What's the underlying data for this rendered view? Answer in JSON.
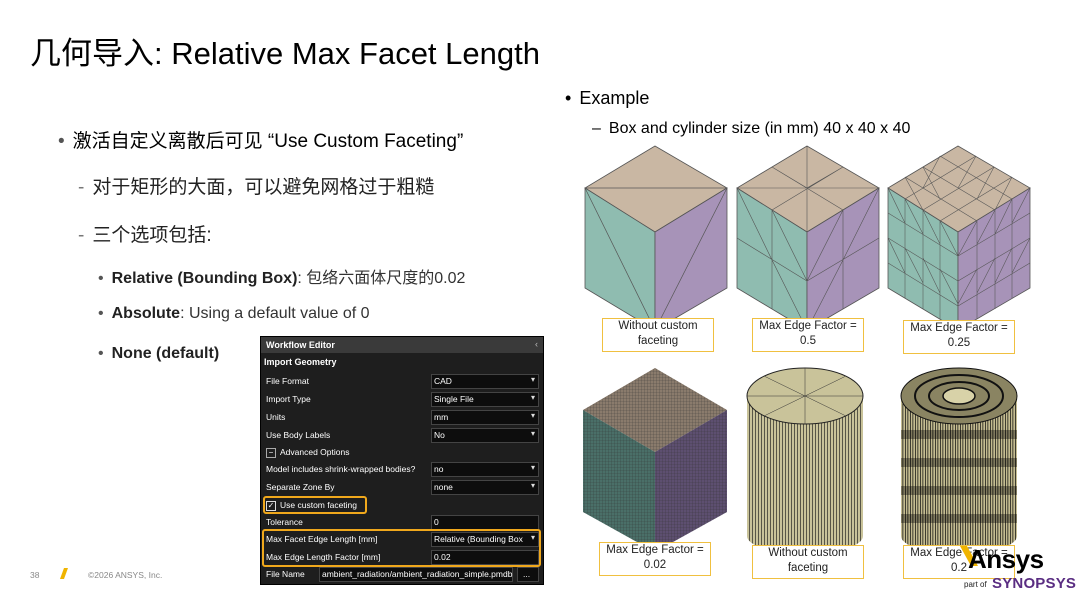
{
  "title": "几何导入: Relative Max Facet Length",
  "left": {
    "bullet1": "激活自定义离散后可见 “Use Custom Faceting”",
    "sub1": "对于矩形的大面，可以避免网格过于粗糙",
    "sub2": "三个选项包括:",
    "opt1_bold": "Relative (Bounding Box)",
    "opt1_rest": ": 包络六面体尺度的0.02",
    "opt2_bold": "Absolute",
    "opt2_rest": ": Using a default value of 0",
    "opt3_bold": "None (default)"
  },
  "right": {
    "example": "Example",
    "size": "Box and cylinder size (in mm) 40 x 40 x 40",
    "captions": [
      "Without custom faceting",
      "Max Edge Factor = 0.5",
      "Max Edge Factor = 0.25",
      "Max Edge Factor = 0.02",
      "Without custom faceting",
      "Max Edge Factor = 0.2"
    ]
  },
  "workflow": {
    "title": "Workflow Editor",
    "section": "Import Geometry",
    "rows": [
      {
        "label": "File Format",
        "value": "CAD"
      },
      {
        "label": "Import Type",
        "value": "Single File"
      },
      {
        "label": "Units",
        "value": "mm"
      },
      {
        "label": "Use Body Labels",
        "value": "No"
      },
      {
        "label": "Advanced Options",
        "value": ""
      },
      {
        "label": "Model includes shrink-wrapped bodies?",
        "value": "no"
      },
      {
        "label": "Separate Zone By",
        "value": "none"
      },
      {
        "label": "Use custom faceting",
        "value": ""
      },
      {
        "label": "Tolerance",
        "value": "0"
      },
      {
        "label": "Max Facet Edge Length [mm]",
        "value": "Relative (Bounding Box"
      },
      {
        "label": "Max Edge Length Factor [mm]",
        "value": "0.02"
      },
      {
        "label": "File Name",
        "value": "ambient_radiation/ambient_radiation_simple.pmdb"
      }
    ]
  },
  "footer": {
    "page": "38",
    "copyright": "©2026 ANSYS, Inc."
  },
  "logo": {
    "brand": "Ansys",
    "partof": "part of",
    "parent": "SYNOPSYS"
  },
  "colors": {
    "top": "#c9b7a3",
    "left": "#8fbcb0",
    "right": "#a793b8",
    "highlight": "#f0a81c",
    "brand_purple": "#5a2d82"
  }
}
